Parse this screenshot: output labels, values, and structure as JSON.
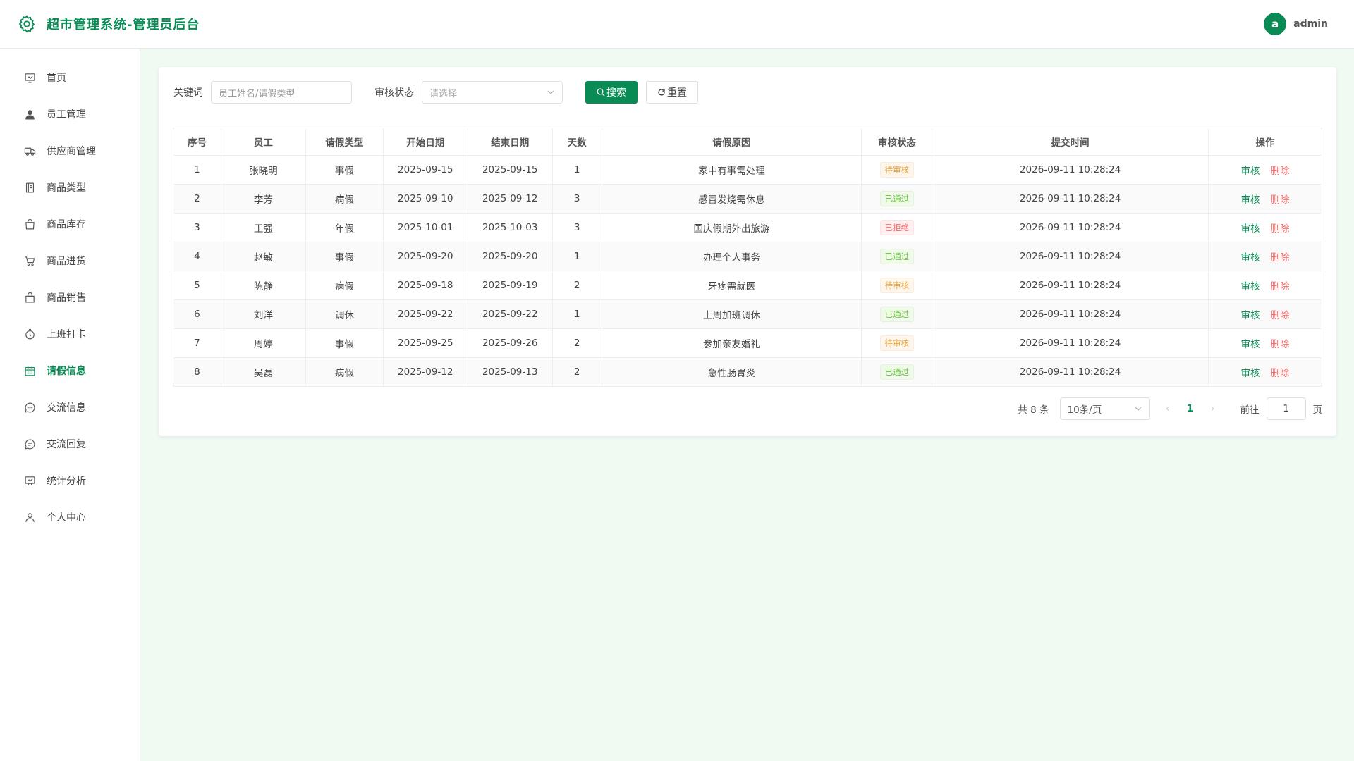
{
  "app": {
    "title": "超市管理系统-管理员后台",
    "brand_color": "#0a8a54"
  },
  "user": {
    "avatar_letter": "a",
    "name": "admin"
  },
  "sidebar": {
    "items": [
      {
        "label": "首页",
        "icon": "dashboard-icon",
        "active": false
      },
      {
        "label": "员工管理",
        "icon": "user-icon",
        "active": false
      },
      {
        "label": "供应商管理",
        "icon": "truck-icon",
        "active": false
      },
      {
        "label": "商品类型",
        "icon": "notebook-icon",
        "active": false
      },
      {
        "label": "商品库存",
        "icon": "bag-icon",
        "active": false
      },
      {
        "label": "商品进货",
        "icon": "cart-icon",
        "active": false
      },
      {
        "label": "商品销售",
        "icon": "sell-icon",
        "active": false
      },
      {
        "label": "上班打卡",
        "icon": "stopwatch-icon",
        "active": false
      },
      {
        "label": "请假信息",
        "icon": "calendar-icon",
        "active": true
      },
      {
        "label": "交流信息",
        "icon": "chat-icon",
        "active": false
      },
      {
        "label": "交流回复",
        "icon": "chat-reply-icon",
        "active": false
      },
      {
        "label": "统计分析",
        "icon": "chart-icon",
        "active": false
      },
      {
        "label": "个人中心",
        "icon": "profile-icon",
        "active": false
      }
    ]
  },
  "filter": {
    "keyword_label": "关键词",
    "keyword_placeholder": "员工姓名/请假类型",
    "status_label": "审核状态",
    "status_placeholder": "请选择",
    "search_label": "搜索",
    "reset_label": "重置"
  },
  "table": {
    "columns": [
      "序号",
      "员工",
      "请假类型",
      "开始日期",
      "结束日期",
      "天数",
      "请假原因",
      "审核状态",
      "提交时间",
      "操作"
    ],
    "rows": [
      {
        "no": "1",
        "employee": "张晓明",
        "type": "事假",
        "start": "2025-09-15",
        "end": "2025-09-15",
        "days": "1",
        "reason": "家中有事需处理",
        "status": "待审核",
        "status_kind": "pending",
        "submitted": "2026-09-11 10:28:24"
      },
      {
        "no": "2",
        "employee": "李芳",
        "type": "病假",
        "start": "2025-09-10",
        "end": "2025-09-12",
        "days": "3",
        "reason": "感冒发烧需休息",
        "status": "已通过",
        "status_kind": "passed",
        "submitted": "2026-09-11 10:28:24"
      },
      {
        "no": "3",
        "employee": "王强",
        "type": "年假",
        "start": "2025-10-01",
        "end": "2025-10-03",
        "days": "3",
        "reason": "国庆假期外出旅游",
        "status": "已拒绝",
        "status_kind": "rejected",
        "submitted": "2026-09-11 10:28:24"
      },
      {
        "no": "4",
        "employee": "赵敏",
        "type": "事假",
        "start": "2025-09-20",
        "end": "2025-09-20",
        "days": "1",
        "reason": "办理个人事务",
        "status": "已通过",
        "status_kind": "passed",
        "submitted": "2026-09-11 10:28:24"
      },
      {
        "no": "5",
        "employee": "陈静",
        "type": "病假",
        "start": "2025-09-18",
        "end": "2025-09-19",
        "days": "2",
        "reason": "牙疼需就医",
        "status": "待审核",
        "status_kind": "pending",
        "submitted": "2026-09-11 10:28:24"
      },
      {
        "no": "6",
        "employee": "刘洋",
        "type": "调休",
        "start": "2025-09-22",
        "end": "2025-09-22",
        "days": "1",
        "reason": "上周加班调休",
        "status": "已通过",
        "status_kind": "passed",
        "submitted": "2026-09-11 10:28:24"
      },
      {
        "no": "7",
        "employee": "周婷",
        "type": "事假",
        "start": "2025-09-25",
        "end": "2025-09-26",
        "days": "2",
        "reason": "参加亲友婚礼",
        "status": "待审核",
        "status_kind": "pending",
        "submitted": "2026-09-11 10:28:24"
      },
      {
        "no": "8",
        "employee": "吴磊",
        "type": "病假",
        "start": "2025-09-12",
        "end": "2025-09-13",
        "days": "2",
        "reason": "急性肠胃炎",
        "status": "已通过",
        "status_kind": "passed",
        "submitted": "2026-09-11 10:28:24"
      }
    ],
    "op_audit": "审核",
    "op_delete": "删除"
  },
  "pagination": {
    "total_text": "共 8 条",
    "page_size": "10条/页",
    "current_page": "1",
    "goto_label": "前往",
    "goto_value": "1",
    "page_unit": "页"
  }
}
